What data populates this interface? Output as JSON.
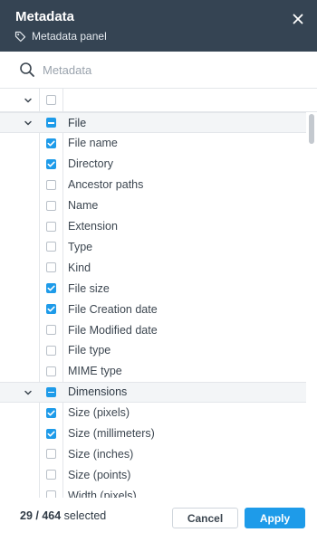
{
  "header": {
    "title": "Metadata",
    "subtitle": "Metadata panel",
    "tag_icon": "tag-icon",
    "close_icon": "close-icon"
  },
  "search": {
    "placeholder": "Metadata",
    "value": "",
    "icon": "search-icon"
  },
  "grid_head": {
    "expand_icon": "chevron-down-icon",
    "select_all_checked": false
  },
  "rows": [
    {
      "label": "File",
      "group": true,
      "state": "mixed",
      "expanded": true
    },
    {
      "label": "File name",
      "group": false,
      "state": "on"
    },
    {
      "label": "Directory",
      "group": false,
      "state": "on"
    },
    {
      "label": "Ancestor paths",
      "group": false,
      "state": "off"
    },
    {
      "label": "Name",
      "group": false,
      "state": "off"
    },
    {
      "label": "Extension",
      "group": false,
      "state": "off"
    },
    {
      "label": "Type",
      "group": false,
      "state": "off"
    },
    {
      "label": "Kind",
      "group": false,
      "state": "off"
    },
    {
      "label": "File size",
      "group": false,
      "state": "on"
    },
    {
      "label": "File Creation date",
      "group": false,
      "state": "on"
    },
    {
      "label": "File Modified date",
      "group": false,
      "state": "off"
    },
    {
      "label": "File type",
      "group": false,
      "state": "off"
    },
    {
      "label": "MIME type",
      "group": false,
      "state": "off"
    },
    {
      "label": "Dimensions",
      "group": true,
      "state": "mixed",
      "expanded": true
    },
    {
      "label": "Size (pixels)",
      "group": false,
      "state": "on"
    },
    {
      "label": "Size (millimeters)",
      "group": false,
      "state": "on"
    },
    {
      "label": "Size (inches)",
      "group": false,
      "state": "off"
    },
    {
      "label": "Size (points)",
      "group": false,
      "state": "off"
    },
    {
      "label": "Width (pixels)",
      "group": false,
      "state": "off"
    }
  ],
  "footer": {
    "selected": "29 / 464",
    "selected_suffix": "selected",
    "cancel_label": "Cancel",
    "apply_label": "Apply"
  },
  "colors": {
    "header_bg": "#354453",
    "accent": "#1e9be9"
  }
}
